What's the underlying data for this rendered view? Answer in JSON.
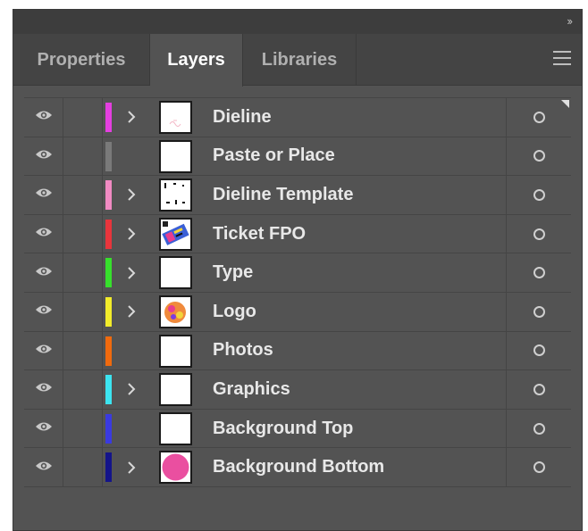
{
  "header": {
    "collapse_icon": "double-chevron-right-icon",
    "collapse_glyph": "››",
    "menu_icon": "hamburger-menu-icon"
  },
  "tabs": [
    {
      "label": "Properties",
      "active": false
    },
    {
      "label": "Layers",
      "active": true
    },
    {
      "label": "Libraries",
      "active": false
    }
  ],
  "layers": [
    {
      "name": "Dieline",
      "color": "#e43fe0",
      "expandable": true,
      "thumbnail": "dieline-sketch",
      "visible": true
    },
    {
      "name": "Paste or Place",
      "color": "#7a7a7a",
      "expandable": false,
      "thumbnail": "blank",
      "visible": true
    },
    {
      "name": "Dieline Template",
      "color": "#f08ac2",
      "expandable": true,
      "thumbnail": "template-marks",
      "visible": true
    },
    {
      "name": "Ticket FPO",
      "color": "#e8353c",
      "expandable": true,
      "thumbnail": "ticket-art",
      "visible": true
    },
    {
      "name": "Type",
      "color": "#37e02c",
      "expandable": true,
      "thumbnail": "blank",
      "visible": true
    },
    {
      "name": "Logo",
      "color": "#f2ec2a",
      "expandable": true,
      "thumbnail": "logo-art",
      "visible": true
    },
    {
      "name": "Photos",
      "color": "#f06a0e",
      "expandable": false,
      "thumbnail": "blank",
      "visible": true
    },
    {
      "name": "Graphics",
      "color": "#3ce4f0",
      "expandable": true,
      "thumbnail": "blank",
      "visible": true
    },
    {
      "name": "Background Top",
      "color": "#3a3ae0",
      "expandable": false,
      "thumbnail": "blank",
      "visible": true
    },
    {
      "name": "Background Bottom",
      "color": "#14148a",
      "expandable": true,
      "thumbnail": "pink-circle",
      "visible": true
    }
  ]
}
